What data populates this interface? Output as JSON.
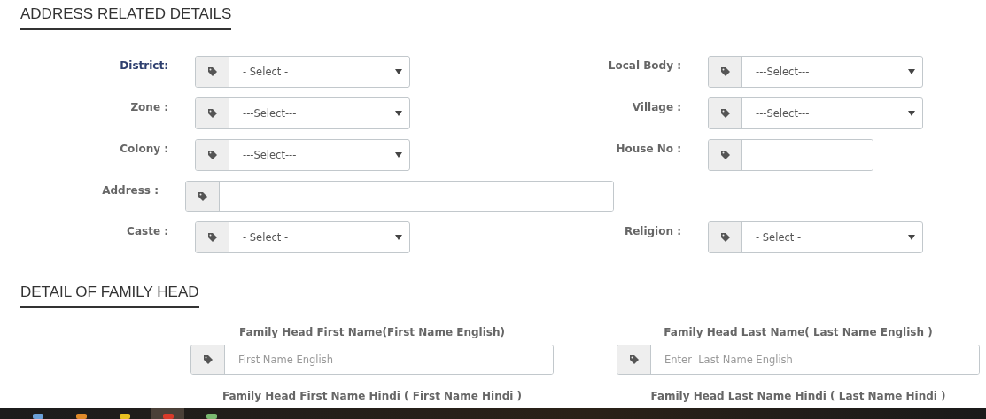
{
  "address_section": {
    "title": "ADDRESS RELATED DETAILS",
    "rows": [
      {
        "left": {
          "label": "District:",
          "kind": "select",
          "value": "- Select -",
          "highlighted": true
        },
        "right": {
          "label": "Local Body :",
          "kind": "select",
          "value": "---Select---",
          "highlighted": false
        }
      },
      {
        "left": {
          "label": "Zone :",
          "kind": "select",
          "value": "---Select---",
          "highlighted": false
        },
        "right": {
          "label": "Village :",
          "kind": "select",
          "value": "---Select---",
          "highlighted": false
        }
      },
      {
        "left": {
          "label": "Colony :",
          "kind": "select",
          "value": "---Select---",
          "highlighted": false
        },
        "right": {
          "label": "House No :",
          "kind": "text",
          "highlighted": false
        }
      },
      {
        "left": {
          "label": "Address :",
          "kind": "wide_text",
          "highlighted": false
        }
      },
      {
        "left": {
          "label": "Caste :",
          "kind": "select",
          "value": "- Select -",
          "highlighted": false
        },
        "right": {
          "label": "Religion :",
          "kind": "select",
          "value": "- Select -",
          "highlighted": false
        }
      }
    ]
  },
  "family_head_section": {
    "title": "DETAIL OF FAMILY HEAD",
    "fields": [
      {
        "label": "Family Head First Name(First Name English)",
        "placeholder": "First Name English"
      },
      {
        "label": "Family Head Last Name( Last Name English )",
        "placeholder": "Enter  Last Name English"
      }
    ],
    "next_labels": [
      "Family Head First Name Hindi ( First Name Hindi )",
      "Family Head Last Name Hindi ( Last Name Hindi )"
    ]
  },
  "taskbar": {
    "items": [
      {
        "selected": false
      },
      {
        "selected": false
      },
      {
        "selected": false
      },
      {
        "selected": true
      },
      {
        "selected": false
      }
    ]
  }
}
